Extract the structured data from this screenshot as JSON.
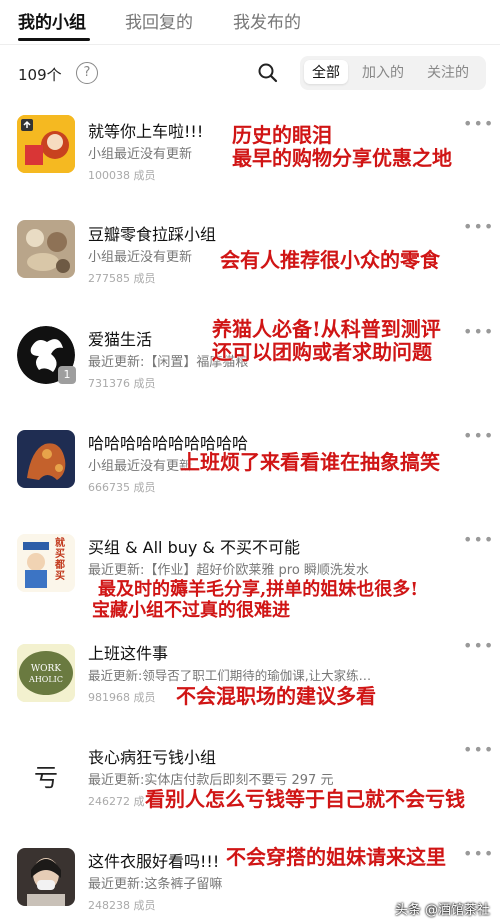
{
  "tabs": [
    "我的小组",
    "我回复的",
    "我发布的"
  ],
  "filter": {
    "count": "109个",
    "segments": [
      "全部",
      "加入的",
      "关注的"
    ]
  },
  "groups": [
    {
      "name": "就等你上车啦!!!",
      "sub": "小组最近没有更新",
      "members": "100038 成员",
      "note_lines": [
        "历史的眼泪",
        "最早的购物分享优惠之地"
      ]
    },
    {
      "name": "豆瓣零食拉踩小组",
      "sub": "小组最近没有更新",
      "members": "277585 成员",
      "note_lines": [
        "会有人推荐很小众的零食"
      ]
    },
    {
      "name": "爱猫生活",
      "sub": "最近更新:【闲置】福摩猫粮",
      "members": "731376 成员",
      "note_lines": [
        "养猫人必备!从科普到测评",
        "还可以团购或者求助问题"
      ]
    },
    {
      "name": "哈哈哈哈哈哈哈哈哈哈",
      "sub": "小组最近没有更新",
      "members": "666735 成员",
      "note_lines": [
        "上班烦了来看看谁在抽象搞笑"
      ]
    },
    {
      "name": "买组 & All buy & 不买不可能",
      "sub": "最近更新:【作业】超好价欧莱雅 pro 瞬顺洗发水",
      "members": "",
      "note_lines": [
        "最及时的薅羊毛分享,拼单的姐妹也很多!",
        "宝藏小组不过真的很难进"
      ]
    },
    {
      "name": "上班这件事",
      "sub": "最近更新:领导否了职工们期待的瑜伽课,让大家练…",
      "members": "981968 成员",
      "note_lines": [
        "不会混职场的建议多看"
      ]
    },
    {
      "name": "丧心病狂亏钱小组",
      "sub": "最近更新:实体店付款后即刻不要亏 297 元",
      "members": "246272 成",
      "note_lines": [
        "看别人怎么亏钱等于自己就不会亏钱"
      ]
    },
    {
      "name": "这件衣服好看吗!!!",
      "sub": "最近更新:这条裤子留嘛",
      "members": "248238 成员",
      "note_lines": [
        "不会穿搭的姐妹请来这里"
      ]
    }
  ],
  "avatar_text": {
    "buy_group": "就买都买",
    "work": "WORK AHOLIC",
    "loss": "亏"
  },
  "chat_badge": "1",
  "watermark": "头条 @酒馆茶社",
  "colors": {
    "annotation": "#d01515",
    "text": "#111111",
    "muted": "#777777"
  }
}
